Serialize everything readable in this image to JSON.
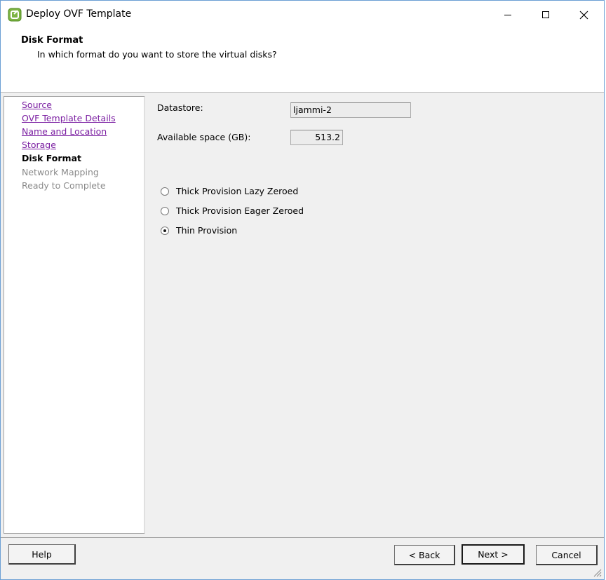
{
  "window": {
    "title": "Deploy OVF Template",
    "icon": "vsphere-deploy-icon"
  },
  "header": {
    "title": "Disk Format",
    "subtitle": "In which format do you want to store the virtual disks?"
  },
  "steps": [
    {
      "label": "Source",
      "state": "link"
    },
    {
      "label": "OVF Template Details",
      "state": "link"
    },
    {
      "label": "Name and Location",
      "state": "link"
    },
    {
      "label": "Storage",
      "state": "link"
    },
    {
      "label": "Disk Format",
      "state": "current"
    },
    {
      "label": "Network Mapping",
      "state": "future"
    },
    {
      "label": "Ready to Complete",
      "state": "future"
    }
  ],
  "content": {
    "datastore_label": "Datastore:",
    "datastore_value": "ljammi-2",
    "space_label": "Available space (GB):",
    "space_value": "513.2",
    "options": [
      {
        "label": "Thick Provision Lazy Zeroed",
        "checked": false
      },
      {
        "label": "Thick Provision Eager Zeroed",
        "checked": false
      },
      {
        "label": "Thin Provision",
        "checked": true
      }
    ]
  },
  "footer": {
    "help_label": "Help",
    "back_label": "< Back",
    "next_label": "Next >",
    "cancel_label": "Cancel"
  },
  "colors": {
    "visited_link": "#7b1fa2",
    "future_step": "#8a8a8a",
    "window_border": "#6a9fd4"
  }
}
